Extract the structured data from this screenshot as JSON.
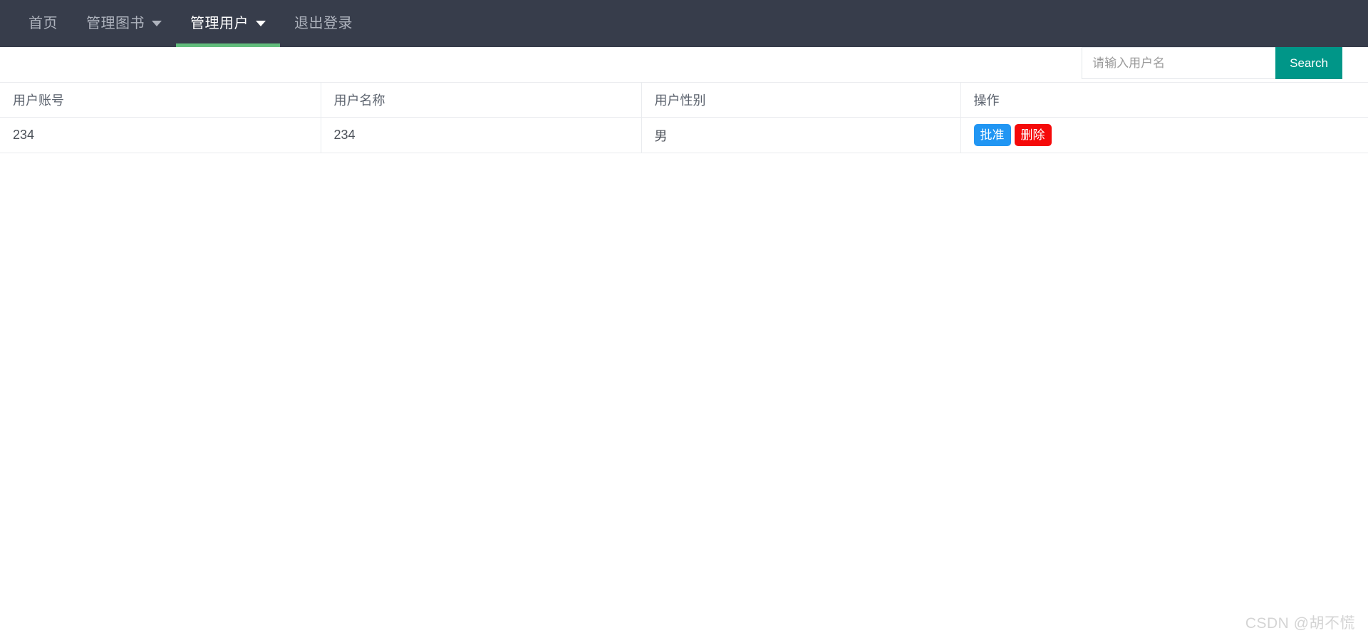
{
  "navbar": {
    "background_color": "#373d4b",
    "active_indicator_color": "#62bd7c",
    "items": [
      {
        "label": "首页",
        "has_caret": false,
        "active": false
      },
      {
        "label": "管理图书",
        "has_caret": true,
        "active": false
      },
      {
        "label": "管理用户",
        "has_caret": true,
        "active": true
      },
      {
        "label": "退出登录",
        "has_caret": false,
        "active": false
      }
    ]
  },
  "search": {
    "placeholder": "请输入用户名",
    "value": "",
    "button_label": "Search",
    "button_color": "#009688"
  },
  "table": {
    "columns": [
      "用户账号",
      "用户名称",
      "用户性别",
      "操作"
    ],
    "rows": [
      {
        "account": "234",
        "name": "234",
        "gender": "男",
        "actions": [
          {
            "label": "批准",
            "color": "#2196f3"
          },
          {
            "label": "删除",
            "color": "#f50a0a"
          }
        ]
      }
    ]
  },
  "watermark": {
    "text": "CSDN @胡不慌"
  }
}
